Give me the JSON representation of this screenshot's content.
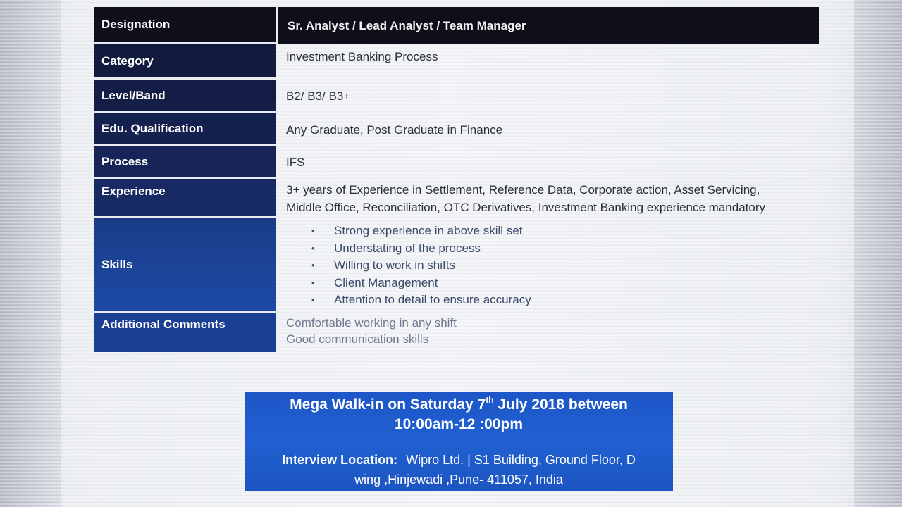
{
  "rows": {
    "designation": {
      "label": "Designation",
      "value": "Sr. Analyst / Lead Analyst / Team Manager"
    },
    "category": {
      "label": "Category",
      "value": "Investment Banking Process"
    },
    "level": {
      "label": "Level/Band",
      "value": "B2/ B3/ B3+"
    },
    "edu": {
      "label": "Edu. Qualification",
      "value": "Any Graduate, Post Graduate in Finance"
    },
    "process": {
      "label": "Process",
      "value": "IFS"
    },
    "experience": {
      "label": "Experience",
      "line1": "3+ years of Experience in Settlement, Reference Data, Corporate action, Asset Servicing,",
      "line2": "Middle Office, Reconciliation, OTC Derivatives, Investment Banking experience mandatory"
    },
    "skills": {
      "label": "Skills",
      "bullet": "•",
      "items": [
        "Strong experience in above skill set",
        "Understating of the process",
        "Willing to work in shifts",
        "Client Management",
        "Attention to detail to ensure accuracy"
      ]
    },
    "comments": {
      "label": "Additional Comments",
      "line1": "Comfortable working in any shift",
      "line2": "Good communication skills"
    }
  },
  "walkin": {
    "line1_prefix": "Mega Walk-in on Saturday 7",
    "line1_sup": "th",
    "line1_suffix": " July 2018 between",
    "line2": "10:00am-12 :00pm",
    "location_label": "Interview Location:",
    "location_line1": "Wipro Ltd. | S1 Building, Ground Floor, D",
    "location_line2": "wing ,Hinjewadi ,Pune- 411057, India"
  },
  "colors": {
    "header_dark": "#0e0f1a",
    "label_navy": "#14204d",
    "label_blue": "#1d4aa6",
    "walkin_blue": "#2060d1"
  }
}
